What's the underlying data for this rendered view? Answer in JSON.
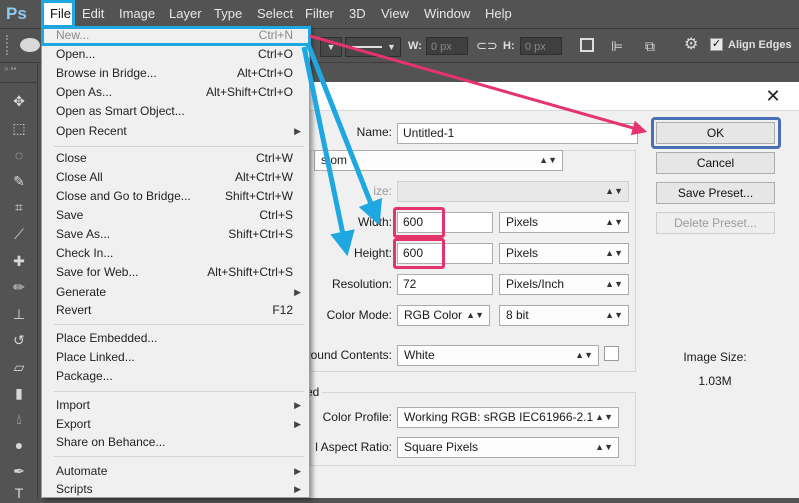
{
  "app": {
    "logo": "Ps"
  },
  "menubar": {
    "items": [
      "File",
      "Edit",
      "Image",
      "Layer",
      "Type",
      "Select",
      "Filter",
      "3D",
      "View",
      "Window",
      "Help"
    ]
  },
  "options": {
    "w_label": "W:",
    "w_value": "0 px",
    "h_label": "H:",
    "h_value": "0 px",
    "align_edges": "Align Edges"
  },
  "file_menu": {
    "items": [
      {
        "label": "New...",
        "shortcut": "Ctrl+N"
      },
      {
        "label": "Open...",
        "shortcut": "Ctrl+O"
      },
      {
        "label": "Browse in Bridge...",
        "shortcut": "Alt+Ctrl+O"
      },
      {
        "label": "Open As...",
        "shortcut": "Alt+Shift+Ctrl+O"
      },
      {
        "label": "Open as Smart Object...",
        "shortcut": ""
      },
      {
        "label": "Open Recent",
        "shortcut": ""
      },
      {
        "label": "Close",
        "shortcut": "Ctrl+W"
      },
      {
        "label": "Close All",
        "shortcut": "Alt+Ctrl+W"
      },
      {
        "label": "Close and Go to Bridge...",
        "shortcut": "Shift+Ctrl+W"
      },
      {
        "label": "Save",
        "shortcut": "Ctrl+S"
      },
      {
        "label": "Save As...",
        "shortcut": "Shift+Ctrl+S"
      },
      {
        "label": "Check In...",
        "shortcut": ""
      },
      {
        "label": "Save for Web...",
        "shortcut": "Alt+Shift+Ctrl+S"
      },
      {
        "label": "Generate",
        "shortcut": ""
      },
      {
        "label": "Revert",
        "shortcut": "F12"
      },
      {
        "label": "Place Embedded...",
        "shortcut": ""
      },
      {
        "label": "Place Linked...",
        "shortcut": ""
      },
      {
        "label": "Package...",
        "shortcut": ""
      },
      {
        "label": "Import",
        "shortcut": ""
      },
      {
        "label": "Export",
        "shortcut": ""
      },
      {
        "label": "Share on Behance...",
        "shortcut": ""
      },
      {
        "label": "Automate",
        "shortcut": ""
      },
      {
        "label": "Scripts",
        "shortcut": ""
      }
    ]
  },
  "dialog": {
    "name_label": "Name:",
    "name_value": "Untitled-1",
    "preset_value": "stom",
    "size_label": "ize:",
    "width_label": "Width:",
    "width_value": "600",
    "width_unit": "Pixels",
    "height_label": "Height:",
    "height_value": "600",
    "height_unit": "Pixels",
    "resolution_label": "Resolution:",
    "resolution_value": "72",
    "resolution_unit": "Pixels/Inch",
    "color_mode_label": "Color Mode:",
    "color_mode_value": "RGB Color",
    "bit_depth_value": "8 bit",
    "background_label": "round Contents:",
    "background_value": "White",
    "advanced_label": "ed",
    "color_profile_label": "Color Profile:",
    "color_profile_value": "Working RGB:  sRGB IEC61966-2.1",
    "aspect_label": "l Aspect Ratio:",
    "aspect_value": "Square Pixels",
    "ok": "OK",
    "cancel": "Cancel",
    "save_preset": "Save Preset...",
    "delete_preset": "Delete Preset...",
    "image_size_label": "Image Size:",
    "image_size_value": "1.03M"
  },
  "colors": {
    "highlight_blue": "#1ea7e0",
    "highlight_red": "#e5336b",
    "ok_outline": "#4a6fb5"
  }
}
